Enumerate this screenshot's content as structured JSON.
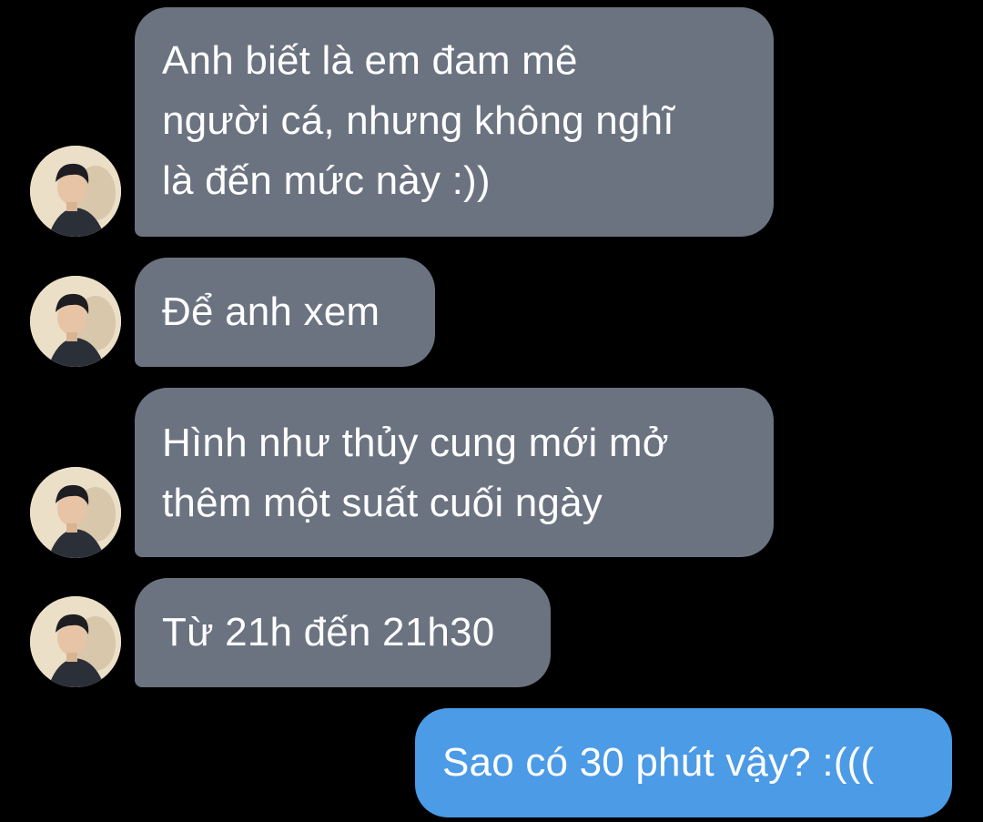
{
  "conversation": {
    "messages": [
      {
        "sender": "incoming",
        "lines": [
          "Anh biết là em đam mê",
          "người cá, nhưng không nghĩ",
          "là đến mức này :))"
        ]
      },
      {
        "sender": "incoming",
        "lines": [
          "Để anh xem"
        ]
      },
      {
        "sender": "incoming",
        "lines": [
          "Hình như thủy cung mới mở",
          "thêm một suất cuối ngày"
        ]
      },
      {
        "sender": "incoming",
        "lines": [
          "Từ 21h đến 21h30"
        ]
      },
      {
        "sender": "outgoing",
        "lines": [
          "Sao có 30 phút vậy? :((("
        ]
      }
    ]
  },
  "colors": {
    "background": "#000000",
    "incoming_bubble": "#6b7380",
    "outgoing_bubble": "#4b9be6",
    "text": "#ffffff"
  },
  "icons": {
    "avatar": "contact-avatar-photo"
  }
}
